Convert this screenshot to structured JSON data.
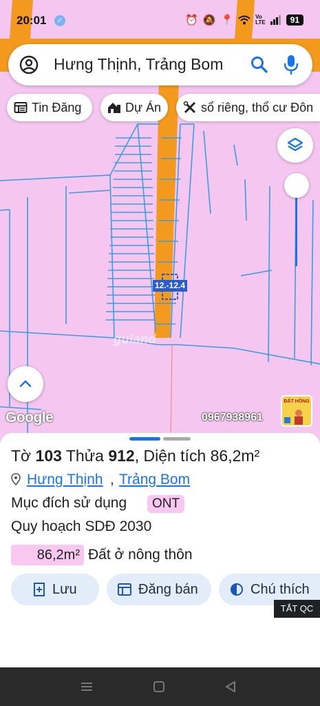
{
  "status": {
    "time": "20:01",
    "lte": "Vo\nLTE",
    "battery": "91"
  },
  "search": {
    "query": "Hưng Thịnh, Trảng Bom"
  },
  "chips": [
    {
      "label": "Tin Đăng",
      "icon": "newspaper-icon"
    },
    {
      "label": "Dự Án",
      "icon": "house-icon"
    },
    {
      "label": "sổ riêng, thổ cư Đôn",
      "icon": "tools-icon"
    }
  ],
  "map": {
    "plot_label": "12.-12.4",
    "watermark": "guland",
    "google": "Google",
    "phone": "0967938961",
    "ad_badge": "ĐẤT HỒNG"
  },
  "parcel": {
    "sheet_prefix": "Tờ ",
    "sheet_no": "103",
    "lot_prefix": " Thửa ",
    "lot_no": "912",
    "area_text": ", Diện tích 86,2m²",
    "ward": "Hưng Thịnh",
    "separator": ",",
    "district": "Trảng Bom",
    "purpose_label": "Mục đích sử dụng",
    "purpose_code": "ONT",
    "plan_label": "Quy hoạch SDĐ 2030",
    "plan_area": "86,2m²",
    "plan_type": "Đất ở nông thôn"
  },
  "actions": {
    "save": "Lưu",
    "post": "Đăng bán",
    "legend": "Chú thích",
    "hide_ad": "TẮT QC"
  },
  "colors": {
    "map_land": "#f4c6f0",
    "road": "#f39a1e",
    "parcel_line": "#3a9de0",
    "accent": "#1a73e8",
    "badge_bg": "#f9c8f1",
    "button_bg": "#e3ecf9"
  }
}
